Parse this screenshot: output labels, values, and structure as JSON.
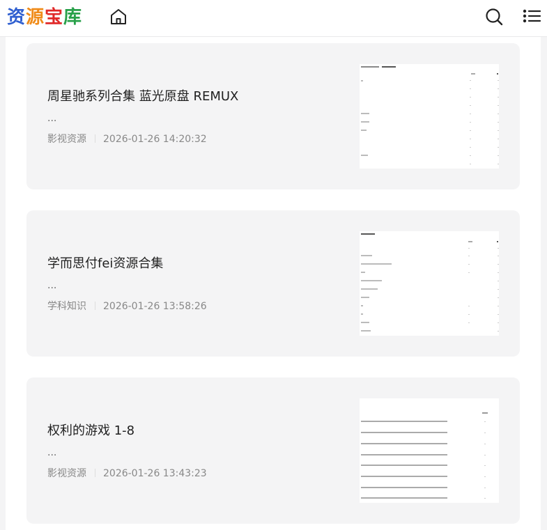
{
  "site": {
    "logo_chars": [
      {
        "char": "资",
        "color": "#2f5fd0"
      },
      {
        "char": "源",
        "color": "#f08c1a"
      },
      {
        "char": "宝",
        "color": "#e02828"
      },
      {
        "char": "库",
        "color": "#27a049"
      }
    ]
  },
  "nav": {
    "home_icon": "home-icon",
    "search_icon": "search-icon",
    "menu_icon": "list-menu-icon"
  },
  "posts": [
    {
      "title": "周星驰系列合集 蓝光原盘 REMUX",
      "excerpt": "...",
      "category": "影视资源",
      "date": "2026-01-26 14:20:32"
    },
    {
      "title": "学而思付fei资源合集",
      "excerpt": "...",
      "category": "学科知识",
      "date": "2026-01-26 13:58:26"
    },
    {
      "title": "权利的游戏 1-8",
      "excerpt": "...",
      "category": "影视资源",
      "date": "2026-01-26 13:43:23"
    }
  ]
}
